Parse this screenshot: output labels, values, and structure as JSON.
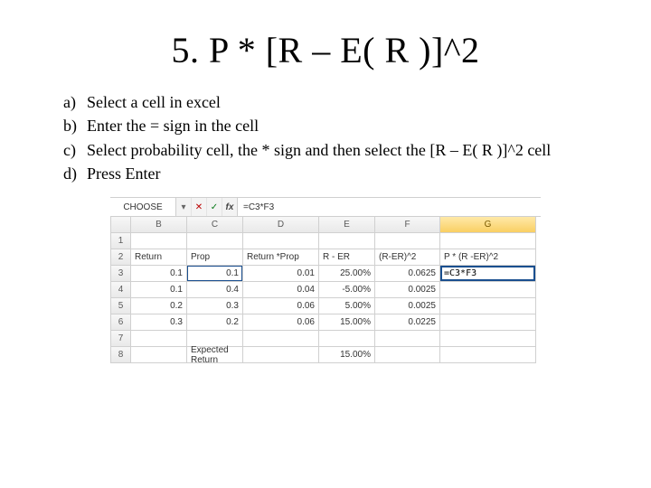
{
  "title": "5. P * [R – E( R )]^2",
  "steps": [
    {
      "label": "a)",
      "text": "Select a cell in excel"
    },
    {
      "label": "b)",
      "text": "Enter the = sign in the cell"
    },
    {
      "label": "c)",
      "text": "Select probability cell, the * sign and then select the [R – E( R )]^2 cell"
    },
    {
      "label": "d)",
      "text": "Press Enter"
    }
  ],
  "excel": {
    "namebox": "CHOOSE",
    "icons": {
      "dropdown": "▾",
      "cancel": "✕",
      "enter": "✓",
      "fx": "fx"
    },
    "formula": "=C3*F3",
    "columns": [
      "",
      "B",
      "C",
      "D",
      "E",
      "F",
      "G"
    ],
    "rows": [
      {
        "n": "1",
        "B": "",
        "C": "",
        "D": "",
        "E": "",
        "F": "",
        "G": ""
      },
      {
        "n": "2",
        "B": "Return",
        "C": "Prop",
        "D": "Return *Prop",
        "E": "R - ER",
        "F": "(R-ER)^2",
        "G": "P * (R -ER)^2"
      },
      {
        "n": "3",
        "B": "0.1",
        "C": "0.1",
        "D": "0.01",
        "E": "25.00%",
        "F": "0.0625",
        "G": "=C3*F3"
      },
      {
        "n": "4",
        "B": "0.1",
        "C": "0.4",
        "D": "0.04",
        "E": "-5.00%",
        "F": "0.0025",
        "G": ""
      },
      {
        "n": "5",
        "B": "0.2",
        "C": "0.3",
        "D": "0.06",
        "E": "5.00%",
        "F": "0.0025",
        "G": ""
      },
      {
        "n": "6",
        "B": "0.3",
        "C": "0.2",
        "D": "0.06",
        "E": "15.00%",
        "F": "0.0225",
        "G": ""
      },
      {
        "n": "7",
        "B": "",
        "C": "",
        "D": "",
        "E": "",
        "F": "",
        "G": ""
      },
      {
        "n": "8",
        "B": "",
        "C": "Expected Return",
        "D": "",
        "E": "15.00%",
        "F": "",
        "G": ""
      }
    ]
  }
}
